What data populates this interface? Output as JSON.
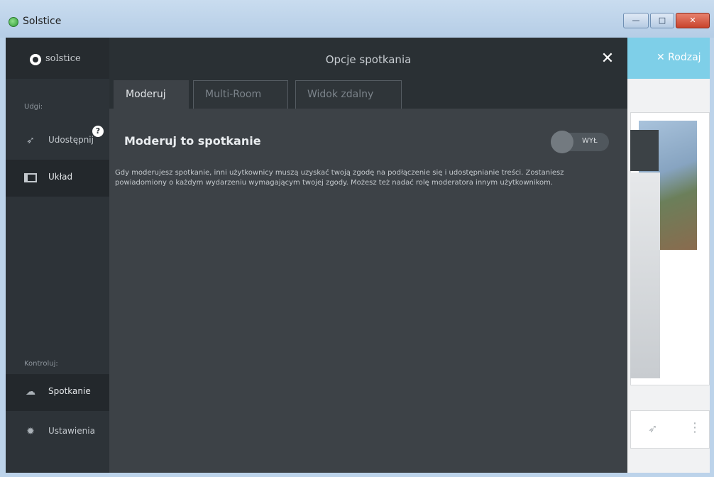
{
  "window": {
    "title": "Solstice",
    "minimize_glyph": "—",
    "maximize_glyph": "□",
    "close_glyph": "✕"
  },
  "sidebar": {
    "logo_text": "solstice",
    "section_share": "Udgi:",
    "section_control": "Kontroluj:",
    "items": [
      {
        "label": "Udostępnij",
        "icon": "share-icon"
      },
      {
        "label": "Układ",
        "icon": "layout-icon",
        "active": true
      },
      {
        "label": "Spotkanie",
        "icon": "meeting-icon"
      },
      {
        "label": "Ustawienia",
        "icon": "gear-icon"
      }
    ],
    "help_glyph": "?"
  },
  "background": {
    "header_button": "✕ Rodzaj"
  },
  "modal": {
    "title": "Opcje spotkania",
    "close_glyph": "✕",
    "tabs": [
      {
        "label": "Moderuj",
        "active": true
      },
      {
        "label": "Multi-Room",
        "active": false
      },
      {
        "label": "Widok zdalny",
        "active": false
      }
    ],
    "option": {
      "title": "Moderuj to spotkanie",
      "toggle_label": "WYŁ",
      "toggle_on": false,
      "description": "Gdy moderujesz spotkanie, inni użytkownicy muszą uzyskać twoją zgodę na podłączenie się i udostępnianie treści. Zostaniesz powiadomiony o każdym wydarzeniu wymagającym twojej zgody. Możesz też nadać rolę moderatora innym użytkownikom."
    }
  },
  "colors": {
    "sidebar_bg": "#2d3338",
    "modal_bg": "#3d4247",
    "modal_header_bg": "#2a3034",
    "accent": "#7ecfe8"
  }
}
